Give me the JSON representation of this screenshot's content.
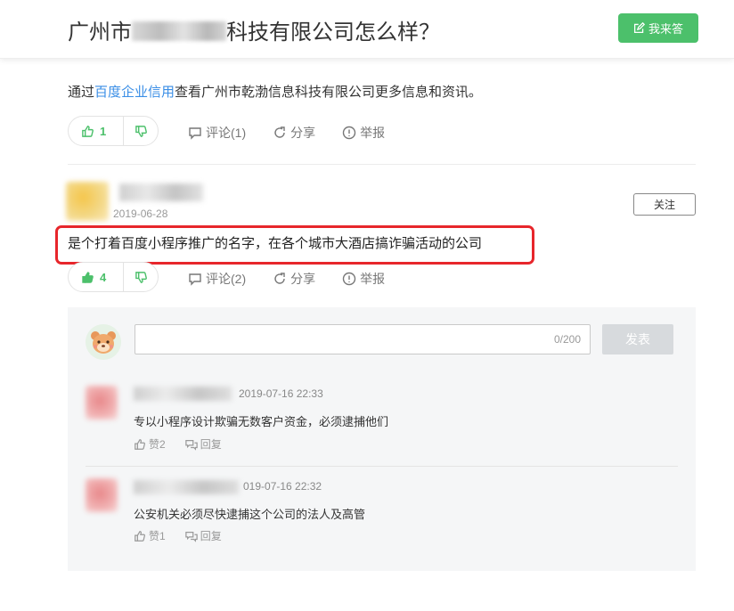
{
  "header": {
    "title_prefix": "广州市",
    "title_suffix": "科技有限公司怎么样？",
    "answer_button": "我来答"
  },
  "intro": {
    "before": "通过",
    "link": "百度企业信用",
    "after": "查看广州市乾渤信息科技有限公司更多信息和资讯。"
  },
  "question_bar": {
    "likes": "1",
    "comment_label": "评论(1)",
    "share_label": "分享",
    "report_label": "举报"
  },
  "answer": {
    "date": "2019-06-28",
    "follow_label": "关注",
    "text": "是个打着百度小程序推广的名字，在各个城市大酒店搞诈骗活动的公司",
    "likes": "4",
    "comment_label": "评论(2)",
    "share_label": "分享",
    "report_label": "举报"
  },
  "comment_box": {
    "counter": "0/200",
    "post_label": "发表"
  },
  "comments": [
    {
      "time": "2019-07-16 22:33",
      "text": "专以小程序设计欺骗无数客户资金，必须逮捕他们",
      "like_label": "赞2",
      "reply_label": "回复"
    },
    {
      "time": "019-07-16 22:32",
      "text": "公安机关必须尽快逮捕这个公司的法人及高管",
      "like_label": "赞1",
      "reply_label": "回复"
    }
  ],
  "colors": {
    "accent_green": "#4cc06b",
    "link_blue": "#3a8ee6",
    "highlight_red": "#e7262b"
  },
  "icons": [
    "edit-icon",
    "thumb-up-icon",
    "thumb-down-icon",
    "comment-icon",
    "share-icon",
    "report-icon",
    "reply-icon"
  ]
}
